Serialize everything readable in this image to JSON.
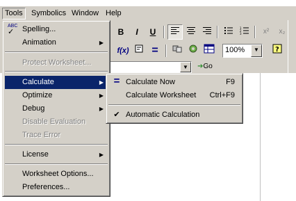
{
  "menubar": {
    "items": [
      "Tools",
      "Symbolics",
      "Window",
      "Help"
    ]
  },
  "toolbar": {
    "bold": "B",
    "italic": "I",
    "underline": "U",
    "superscript": "x²",
    "subscript": "x₂",
    "zoom_value": "100%",
    "go_label": "Go"
  },
  "tools_menu": {
    "items": [
      {
        "label": "Spelling...",
        "icon": "spellcheck-icon"
      },
      {
        "label": "Animation"
      },
      {
        "label": "Protect Worksheet..."
      },
      {
        "label": "Calculate"
      },
      {
        "label": "Optimize"
      },
      {
        "label": "Debug"
      },
      {
        "label": "Disable Evaluation"
      },
      {
        "label": "Trace Error"
      },
      {
        "label": "License"
      },
      {
        "label": "Worksheet Options..."
      },
      {
        "label": "Preferences..."
      }
    ]
  },
  "calculate_submenu": {
    "items": [
      {
        "label": "Calculate Now",
        "shortcut": "F9"
      },
      {
        "label": "Calculate Worksheet",
        "shortcut": "Ctrl+F9"
      },
      {
        "label": "Automatic Calculation",
        "checked": true
      }
    ]
  },
  "colors": {
    "menu_bg": "#d4d0c8",
    "highlight": "#0a246a",
    "disabled_text": "#808080"
  }
}
